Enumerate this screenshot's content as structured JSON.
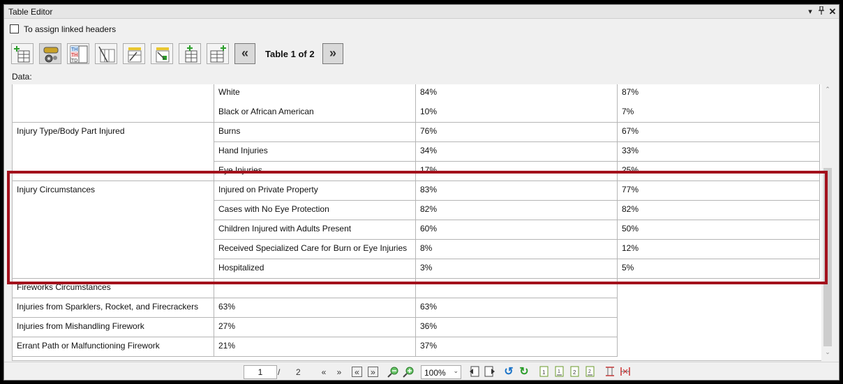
{
  "window": {
    "title": "Table Editor",
    "controls": [
      "chevron-down-icon",
      "pin-icon",
      "close-icon"
    ]
  },
  "options": {
    "assign_linked_headers_label": "To assign linked headers",
    "assign_linked_headers_checked": false
  },
  "toolbar": {
    "tools": [
      "insert-table-icon",
      "link-settings-icon",
      "th-td-icon",
      "column-lines-icon",
      "header-row-icon",
      "header-column-icon",
      "add-column-icon",
      "add-table-icon"
    ],
    "prev_table": "«",
    "table_label": "Table 1 of 2",
    "next_table": "»"
  },
  "data_label": "Data:",
  "table": {
    "rows": [
      [
        "",
        "White",
        "84%",
        "87%"
      ],
      [
        "",
        "Black or African American",
        "10%",
        "7%"
      ],
      [
        "Injury Type/Body Part Injured",
        "Burns",
        "76%",
        "67%"
      ],
      [
        "",
        "Hand Injuries",
        "34%",
        "33%"
      ],
      [
        "",
        "Eye Injuries",
        "17%",
        "25%"
      ],
      [
        "Injury Circumstances",
        "Injured on Private Property",
        "83%",
        "77%"
      ],
      [
        "",
        "Cases with No Eye Protection",
        "82%",
        "82%"
      ],
      [
        "",
        "Children Injured with Adults Present",
        "60%",
        "50%"
      ],
      [
        "",
        "Received Specialized Care for Burn or Eye Injuries",
        "8%",
        "12%"
      ],
      [
        "",
        "Hospitalized",
        "3%",
        "5%"
      ],
      [
        "Fireworks Circumstances",
        "",
        ""
      ],
      [
        "Injuries from Sparklers, Rocket, and Firecrackers",
        "63%",
        "63%"
      ],
      [
        "Injuries from Mishandling Firework",
        "27%",
        "36%"
      ],
      [
        "Errant Path or Malfunctioning Firework",
        "21%",
        "37%"
      ]
    ]
  },
  "pager": {
    "current_page": "1",
    "separator": "/",
    "total_pages": "2",
    "zoom": "100%",
    "zoom_options": [
      "100%"
    ]
  },
  "colors": {
    "highlight_border": "#a3111c",
    "toolbar_accent": "#1a73c8"
  }
}
